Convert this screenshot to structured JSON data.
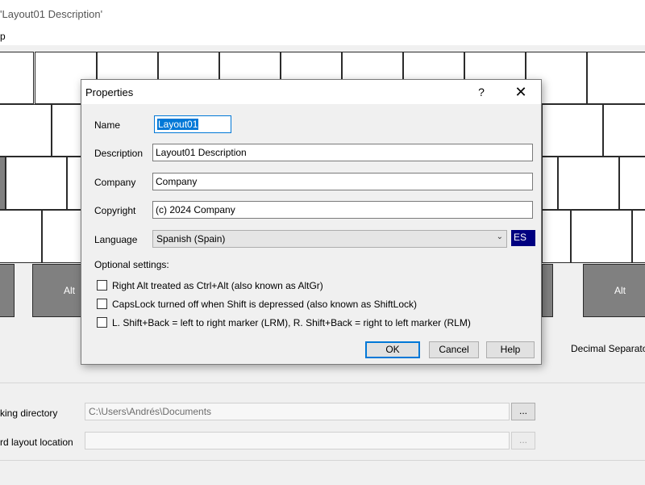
{
  "background_window": {
    "title": "'Layout01 Description'",
    "menu_partial": "p",
    "mod_key_label": "Alt",
    "decimal_separator_label": "Decimal Separato",
    "working_directory_label": "king directory",
    "working_directory_value": "C:\\Users\\Andrés\\Documents",
    "keyboard_location_label": "rd layout location",
    "keyboard_location_value": "",
    "browse_label": "..."
  },
  "dialog": {
    "title": "Properties",
    "help_glyph": "?",
    "close_glyph": "✕",
    "name_label": "Name",
    "name_value": "Layout01",
    "description_label": "Description",
    "description_value": "Layout01 Description",
    "company_label": "Company",
    "company_value": "Company",
    "copyright_label": "Copyright",
    "copyright_value": "(c) 2024 Company",
    "language_label": "Language",
    "language_value": "Spanish (Spain)",
    "language_code": "ES",
    "optional_settings_label": "Optional settings:",
    "options": [
      {
        "label": "Right Alt treated as Ctrl+Alt (also known as AltGr)",
        "checked": false
      },
      {
        "label": "CapsLock turned off when Shift is depressed (also known as ShiftLock)",
        "checked": false
      },
      {
        "label": "L. Shift+Back = left to right marker (LRM),  R. Shift+Back = right to left marker (RLM)",
        "checked": false
      }
    ],
    "ok_label": "OK",
    "cancel_label": "Cancel",
    "help_label": "Help"
  },
  "colors": {
    "selection": "#0078d7",
    "language_code_bg": "#000080",
    "mod_key_bg": "#808080"
  }
}
